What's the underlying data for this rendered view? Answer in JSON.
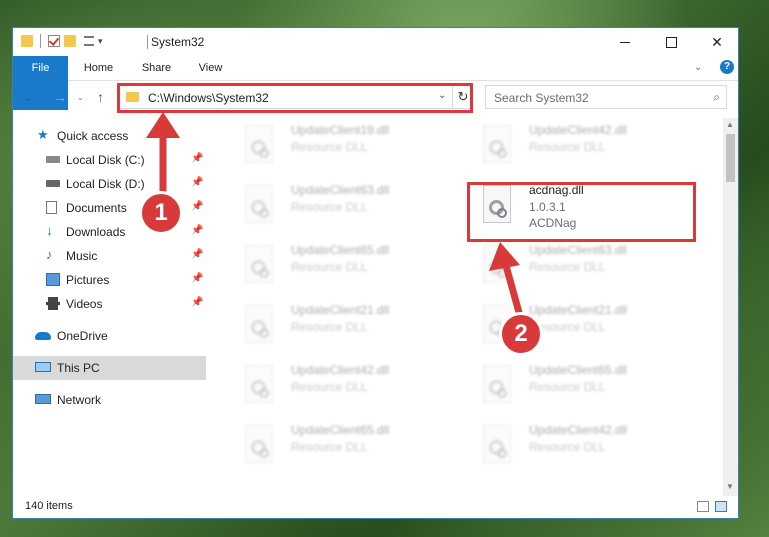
{
  "window": {
    "title": "System32",
    "icons": {
      "folder": "folder-icon",
      "properties": "properties-icon",
      "new_folder": "new-folder-icon",
      "customize": "customize-qat-icon"
    }
  },
  "ribbon": {
    "tabs": [
      "File",
      "Home",
      "Share",
      "View"
    ],
    "help": "?"
  },
  "navigation": {
    "back": "←",
    "forward": "→",
    "recent": "⌄",
    "up": "↑",
    "address": "C:\\Windows\\System32",
    "refresh": "↻",
    "search_placeholder": "Search System32"
  },
  "sidebar": {
    "items": [
      {
        "label": "Quick access",
        "icon": "star-icon",
        "pinned": false
      },
      {
        "label": "Local Disk (C:)",
        "icon": "drive-icon",
        "pinned": true
      },
      {
        "label": "Local Disk (D:)",
        "icon": "drive-icon",
        "pinned": true
      },
      {
        "label": "Documents",
        "icon": "documents-icon",
        "pinned": true
      },
      {
        "label": "Downloads",
        "icon": "downloads-icon",
        "pinned": true
      },
      {
        "label": "Music",
        "icon": "music-icon",
        "pinned": true
      },
      {
        "label": "Pictures",
        "icon": "pictures-icon",
        "pinned": true
      },
      {
        "label": "Videos",
        "icon": "videos-icon",
        "pinned": true
      },
      {
        "label": "OneDrive",
        "icon": "onedrive-icon",
        "pinned": false
      },
      {
        "label": "This PC",
        "icon": "pc-icon",
        "pinned": false,
        "selected": true
      },
      {
        "label": "Network",
        "icon": "network-icon",
        "pinned": false
      }
    ]
  },
  "files": {
    "left": [
      {
        "name": "UpdateClient19.dll",
        "type": "Resource DLL"
      },
      {
        "name": "UpdateClient63.dll",
        "type": "Resource DLL"
      },
      {
        "name": "UpdateClient65.dll",
        "type": "Resource DLL"
      },
      {
        "name": "UpdateClient21.dll",
        "type": "Resource DLL"
      },
      {
        "name": "UpdateClient42.dll",
        "type": "Resource DLL"
      },
      {
        "name": "UpdateClient65.dll",
        "type": "Resource DLL"
      }
    ],
    "right": [
      {
        "name": "UpdateClient42.dll",
        "type": "Resource DLL"
      },
      {
        "name": "acdnag.dll",
        "version": "1.0.3.1",
        "type": "ACDNag",
        "highlighted": true
      },
      {
        "name": "UpdateClient63.dll",
        "type": "Resource DLL"
      },
      {
        "name": "UpdateClient21.dll",
        "type": "Resource DLL"
      },
      {
        "name": "UpdateClient65.dll",
        "type": "Resource DLL"
      },
      {
        "name": "UpdateClient42.dll",
        "type": "Resource DLL"
      }
    ]
  },
  "status": {
    "count": "140 items"
  },
  "annotations": {
    "step1": "1",
    "step2": "2",
    "color": "#d83a3a"
  }
}
